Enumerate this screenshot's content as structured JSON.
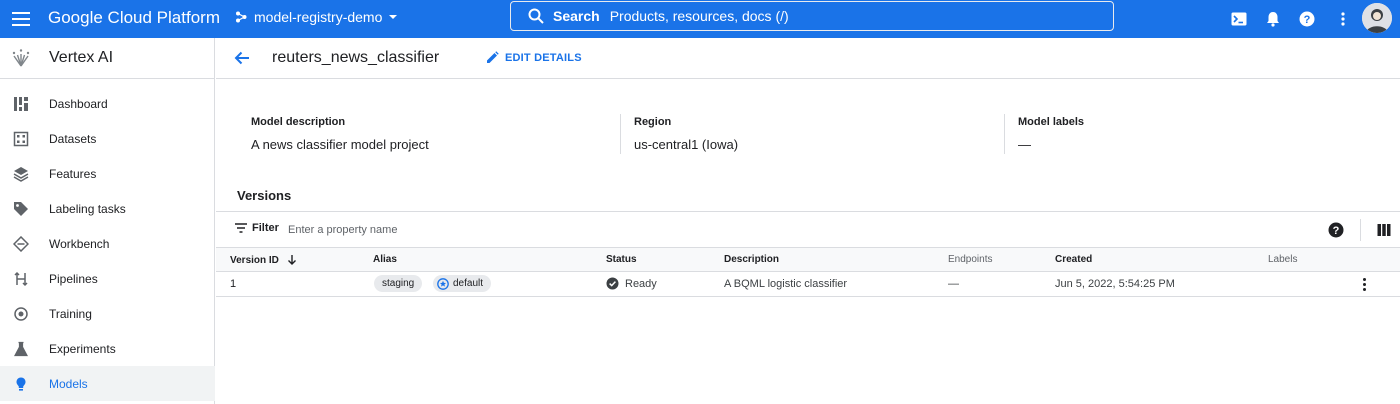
{
  "topbar": {
    "brand": "Google Cloud Platform",
    "project": "model-registry-demo",
    "search_label": "Search",
    "search_placeholder": "Products, resources, docs (/)",
    "bg_color": "#1a73e8"
  },
  "sidebar": {
    "title": "Vertex AI",
    "items": [
      {
        "label": "Dashboard",
        "icon": "dashboard-icon"
      },
      {
        "label": "Datasets",
        "icon": "datasets-icon"
      },
      {
        "label": "Features",
        "icon": "features-icon"
      },
      {
        "label": "Labeling tasks",
        "icon": "label-icon"
      },
      {
        "label": "Workbench",
        "icon": "workbench-icon"
      },
      {
        "label": "Pipelines",
        "icon": "pipelines-icon"
      },
      {
        "label": "Training",
        "icon": "training-icon"
      },
      {
        "label": "Experiments",
        "icon": "flask-icon"
      },
      {
        "label": "Models",
        "icon": "lightbulb-icon",
        "active": true
      }
    ]
  },
  "main": {
    "model_name": "reuters_news_classifier",
    "edit_label": "EDIT DETAILS",
    "details": {
      "description_label": "Model description",
      "description_value": "A news classifier model project",
      "region_label": "Region",
      "region_value": "us-central1 (Iowa)",
      "labels_label": "Model labels",
      "labels_value": "—"
    },
    "versions_heading": "Versions",
    "filter": {
      "label": "Filter",
      "placeholder": "Enter a property name"
    },
    "table": {
      "columns": [
        "Version ID",
        "Alias",
        "Status",
        "Description",
        "Endpoints",
        "Created",
        "Labels"
      ],
      "rows": [
        {
          "version_id": "1",
          "aliases": [
            "staging",
            "default"
          ],
          "status": "Ready",
          "description": "A BQML logistic classifier",
          "endpoints": "—",
          "created": "Jun 5, 2022, 5:54:25 PM",
          "labels": ""
        }
      ]
    }
  }
}
